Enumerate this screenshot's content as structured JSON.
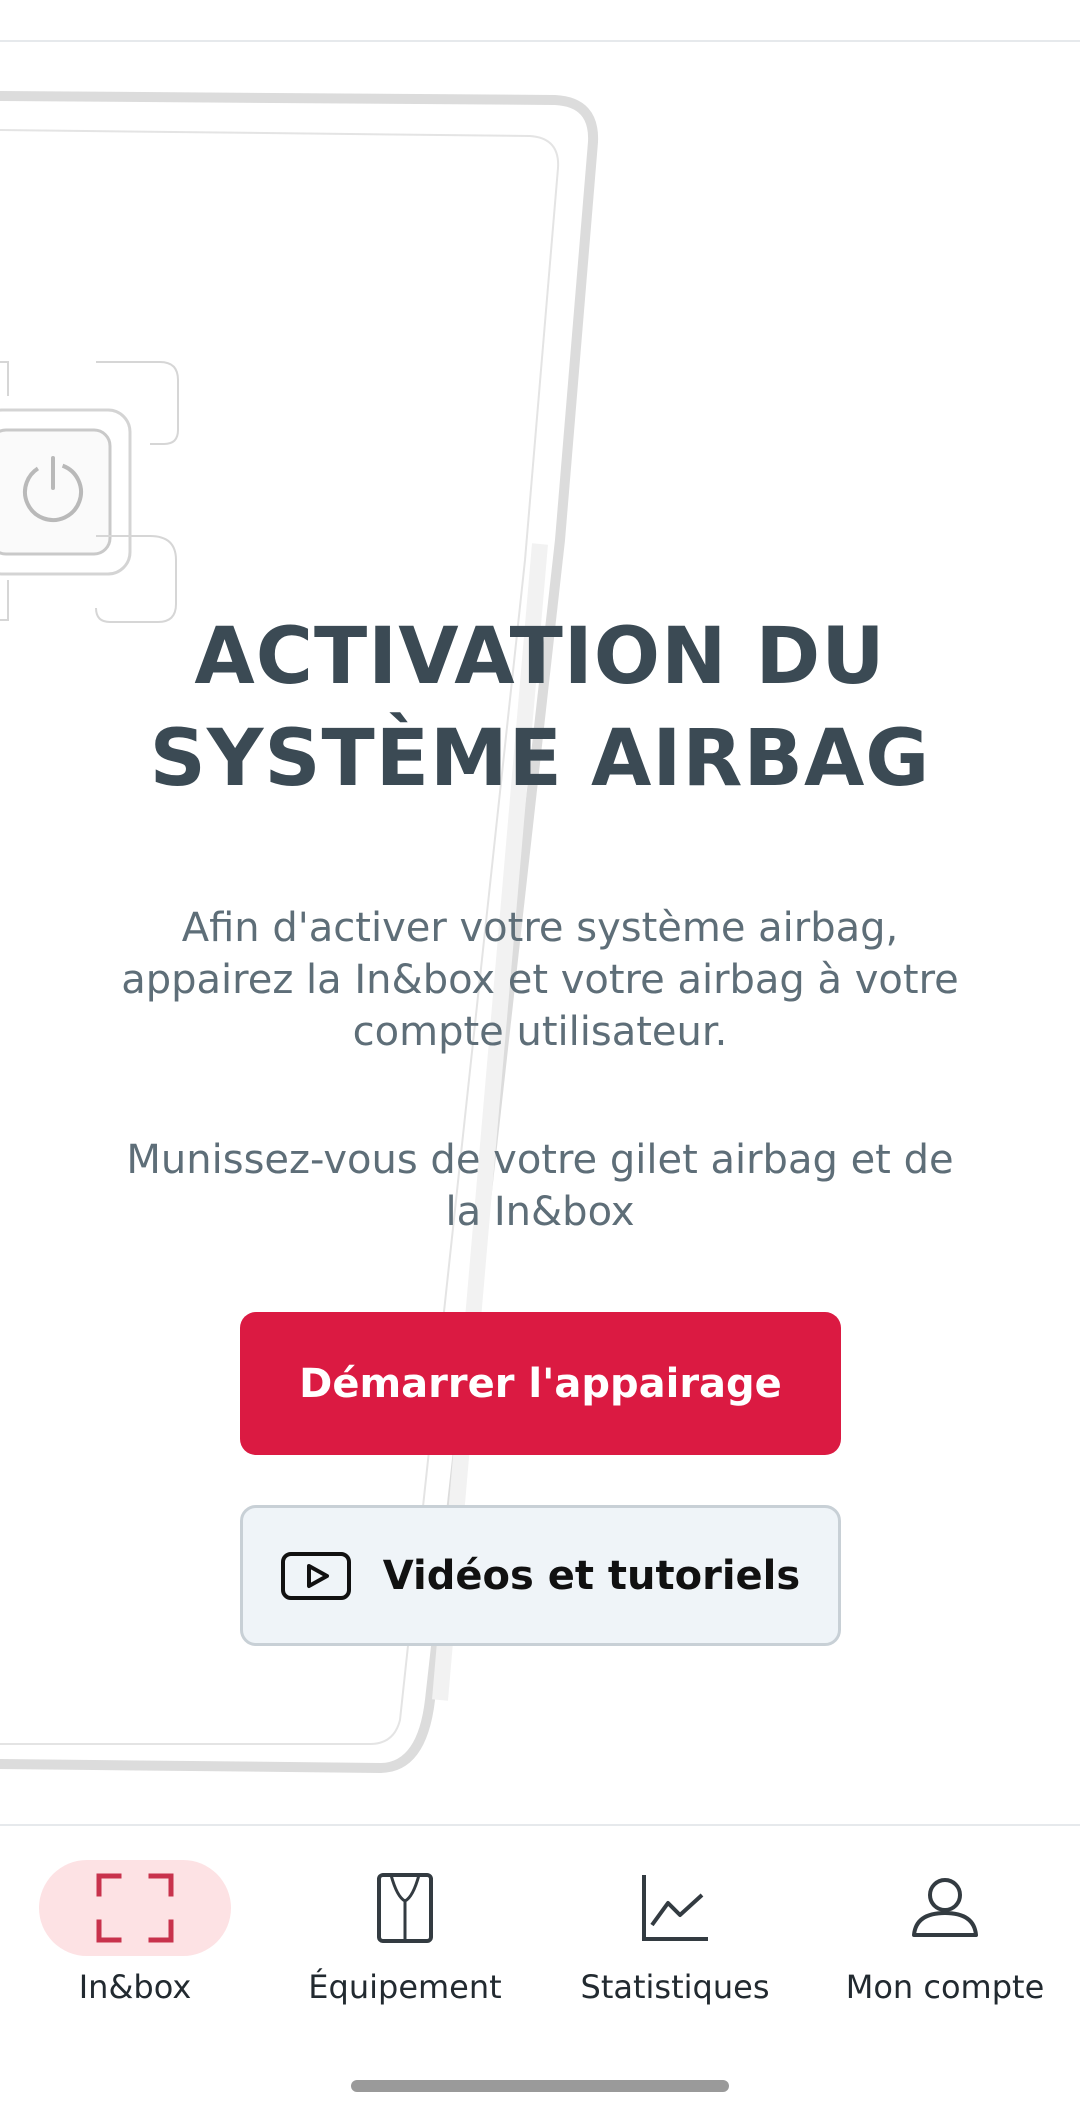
{
  "screen": {
    "title": "ACTIVATION DU SYSTÈME AIRBAG",
    "intro": "Afin d'activer votre système airbag, appairez la In&box et votre airbag à votre compte utilisateur.",
    "prepare": "Munissez-vous de votre gilet airbag et de la In&box"
  },
  "actions": {
    "start_pairing": "Démarrer l'appairage",
    "videos_tutorials": "Vidéos et tutoriels"
  },
  "bottom_nav": {
    "items": [
      {
        "label": "In&box",
        "icon": "inbox-scan-icon",
        "active": true
      },
      {
        "label": "Équipement",
        "icon": "vest-icon",
        "active": false
      },
      {
        "label": "Statistiques",
        "icon": "chart-icon",
        "active": false
      },
      {
        "label": "Mon compte",
        "icon": "user-icon",
        "active": false
      }
    ]
  },
  "colors": {
    "accent": "#db1a42",
    "title": "#3b4a54",
    "body_text": "#5e6e78",
    "active_nav_bg": "#fde2e4"
  }
}
